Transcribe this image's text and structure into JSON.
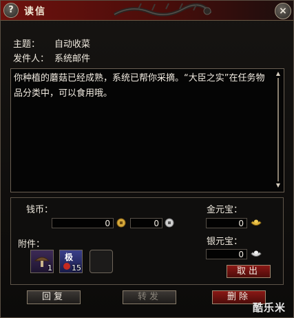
{
  "window": {
    "title": "读信",
    "help_label": "?",
    "close_label": "×"
  },
  "header": {
    "subject_label": "主题：",
    "subject_value": "自动收菜",
    "sender_label": "发件人：",
    "sender_value": "系统邮件"
  },
  "message": {
    "body": "你种植的蘑菇已经成熟，系统已帮你采摘。“大臣之实”在任务物品分类中，可以食用哦。"
  },
  "attachments": {
    "coins_label": "钱币：",
    "coin_value_1": "0",
    "coin_value_2": "0",
    "gold_ingot_label": "金元宝：",
    "gold_ingot_value": "0",
    "silver_ingot_label": "银元宝：",
    "silver_ingot_value": "0",
    "items_label": "附件：",
    "items": [
      {
        "icon": "mushroom-icon",
        "count": "1"
      },
      {
        "icon": "scroll-icon",
        "badge": "极",
        "count": "15"
      },
      {
        "icon": "empty-slot",
        "count": ""
      }
    ],
    "take_label": "取出"
  },
  "footer": {
    "reply_label": "回复",
    "forward_label": "转发",
    "delete_label": "删除"
  },
  "watermark": "酷乐米",
  "colors": {
    "title_red": "#6e120e",
    "button_red": "#8a1815",
    "border": "#6a5f52"
  }
}
